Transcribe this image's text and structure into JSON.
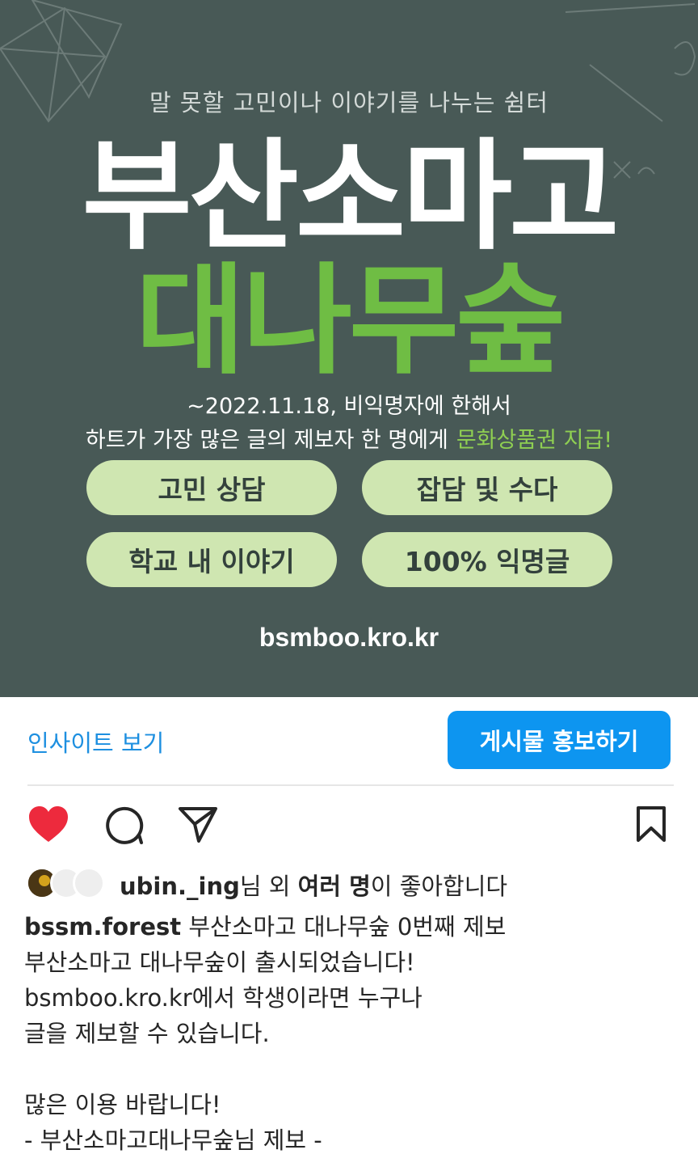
{
  "poster": {
    "tagline": "말 못할 고민이나 이야기를 나누는 쉼터",
    "title_line1": "부산소마고",
    "title_line2": "대나무숲",
    "notice_line1": "~2022.11.18, 비익명자에 한해서",
    "notice_line2": "하트가 가장 많은 글의 제보자 한 명에게",
    "notice_highlight": "문화상품권 지급!",
    "pills": [
      "고민 상담",
      "잡담 및 수다",
      "학교 내 이야기",
      "100% 익명글"
    ],
    "site": "bsmboo.kro.kr",
    "colors": {
      "background": "#485956",
      "title_green": "#6fbd44",
      "pill": "#cfe6b1"
    }
  },
  "actions": {
    "insights_label": "인사이트 보기",
    "promote_label": "게시물 홍보하기"
  },
  "icons": [
    "heart-icon",
    "comment-icon",
    "share-icon",
    "bookmark-icon"
  ],
  "likes": {
    "user": "ubin._ing",
    "suffix1": "님 외 ",
    "bold": "여러 명",
    "suffix2": "이 좋아합니다"
  },
  "caption": {
    "username": "bssm.forest",
    "first_line": " 부산소마고 대나무숲 0번째 제보",
    "lines": [
      "부산소마고 대나무숲이 출시되었습니다!",
      "bsmboo.kro.kr에서 학생이라면 누구나",
      "글을 제보할 수 있습니다.",
      "",
      "많은 이용 바랍니다!",
      "- 부산소마고대나무숲님 제보 -"
    ]
  }
}
